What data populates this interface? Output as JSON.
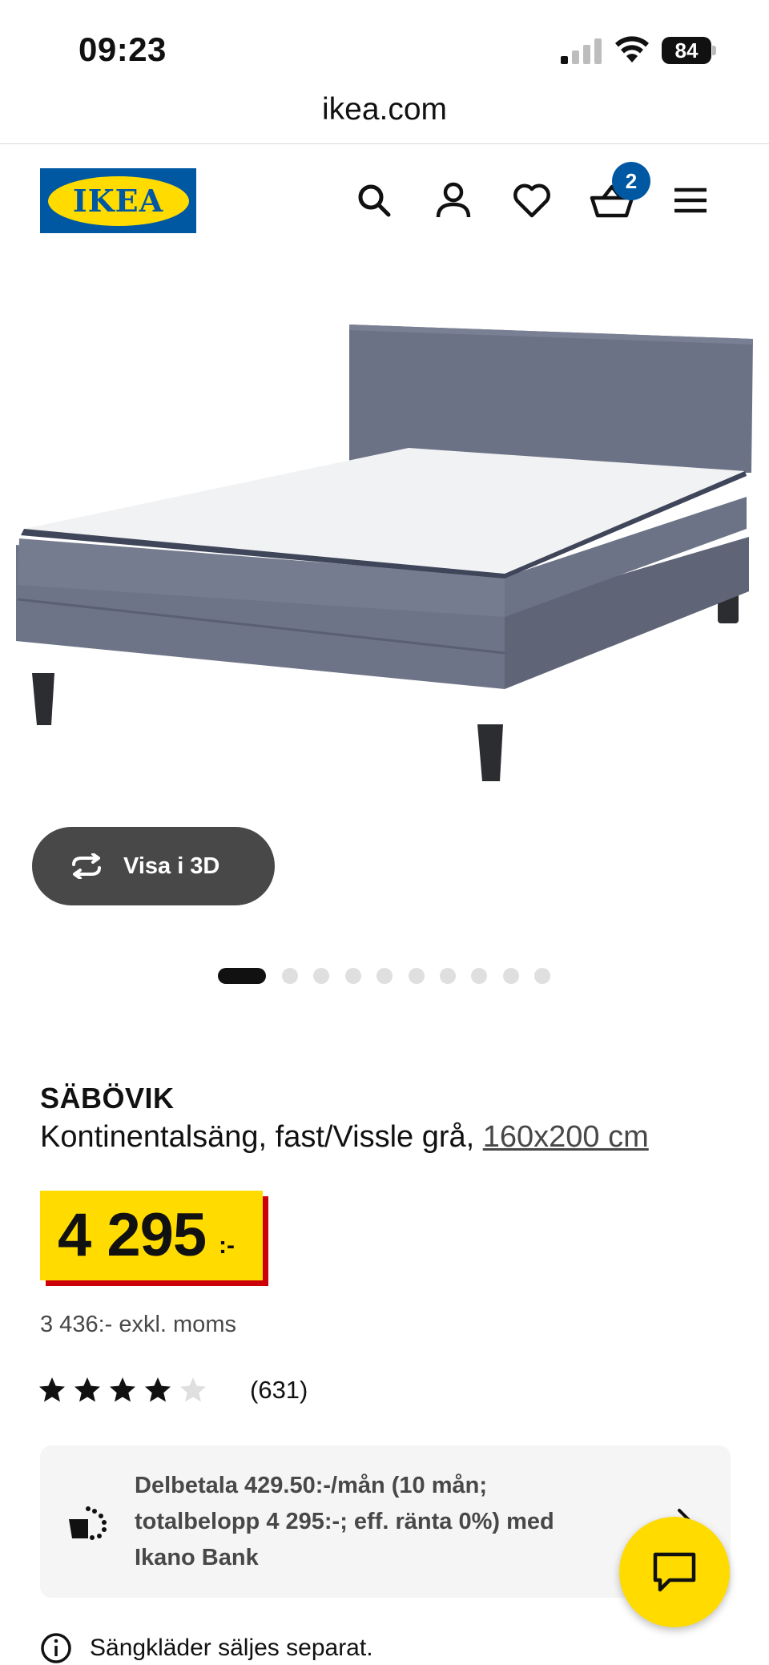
{
  "status_bar": {
    "time": "09:23",
    "battery": "84"
  },
  "browser": {
    "url": "ikea.com"
  },
  "header": {
    "logo_text": "IKEA",
    "cart_count": "2",
    "icons": [
      "search-icon",
      "account-icon",
      "heart-icon",
      "cart-icon",
      "menu-icon"
    ]
  },
  "gallery": {
    "view3d_label": "Visa i 3D",
    "dot_count": 10,
    "active_dot": 0
  },
  "product": {
    "name": "SÄBÖVIK",
    "description": "Kontinentalsäng, fast/Vissle grå, ",
    "size": "160x200 cm",
    "price": "4 295",
    "price_suffix": ":-",
    "price_excl_vat": "3 436:- exkl. moms",
    "rating_stars": 4,
    "rating_max": 5,
    "rating_count": "(631)"
  },
  "finance": {
    "text": "Delbetala 429.50:-/mån (10 mån; totalbelopp 4 295:-; eff. ränta 0%) med Ikano Bank"
  },
  "notice": {
    "text": "Sängkläder säljes separat."
  },
  "colors": {
    "ikea_blue": "#0058a3",
    "ikea_yellow": "#ffdb00",
    "price_shadow_red": "#cc0008"
  }
}
